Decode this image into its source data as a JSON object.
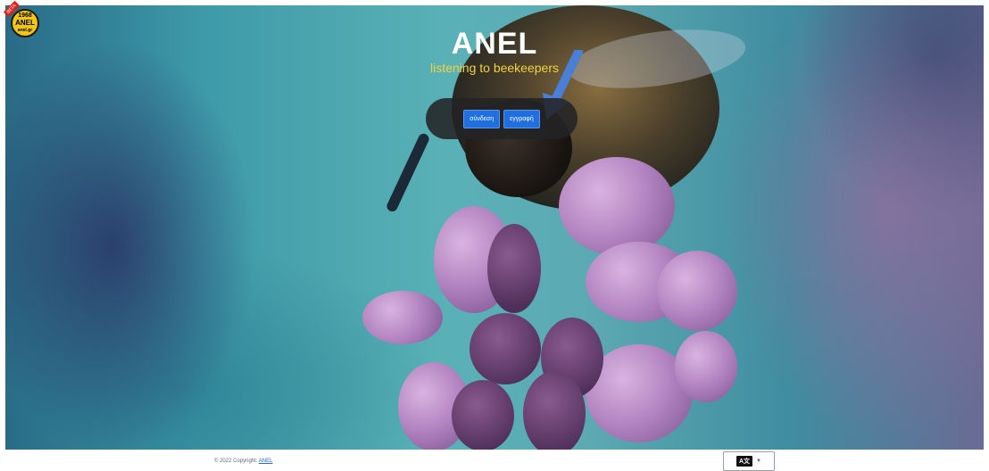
{
  "hero": {
    "title": "ANEL",
    "tagline": "listening to beekeepers",
    "background": "bee-on-lavender-photo"
  },
  "logo": {
    "year": "1968",
    "name": "ANEL",
    "subtitle": "anel.gr",
    "ribbon": "BETA"
  },
  "auth": {
    "login_label": "σύνδεση",
    "register_label": "εγγραφή"
  },
  "annotation": {
    "arrow_icon": "arrow-pointer-icon",
    "color": "#4a7fd8"
  },
  "footer": {
    "copyright": "© 2022 Copyright:",
    "brand_link": "ANEL",
    "language_icon": "A文"
  },
  "colors": {
    "accent": "#1f6fe0",
    "tagline": "#f1d23e"
  }
}
